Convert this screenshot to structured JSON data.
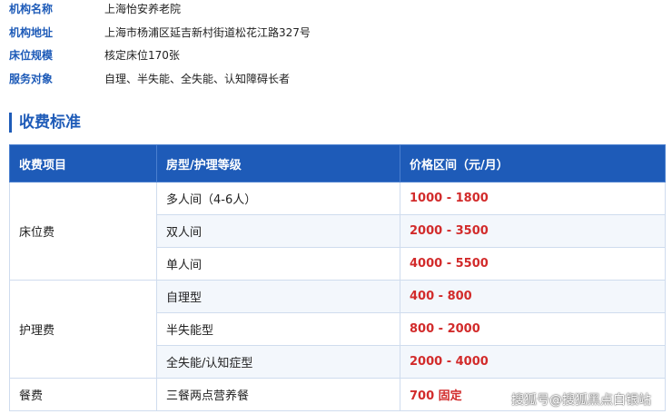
{
  "info": [
    {
      "label": "机构名称",
      "value": "上海怡安养老院"
    },
    {
      "label": "机构地址",
      "value": "上海市杨浦区延吉新村街道松花江路327号"
    },
    {
      "label": "床位规模",
      "value": "核定床位170张"
    },
    {
      "label": "服务对象",
      "value": "自理、半失能、全失能、认知障碍长者"
    }
  ],
  "section_title": "收费标准",
  "table": {
    "headers": [
      "收费项目",
      "房型/护理等级",
      "价格区间（元/月）"
    ],
    "groups": [
      {
        "category": "床位费",
        "rows": [
          {
            "sub": "多人间（4-6人）",
            "price": "1000 - 1800"
          },
          {
            "sub": "双人间",
            "price": "2000 - 3500"
          },
          {
            "sub": "单人间",
            "price": "4000 - 5500"
          }
        ]
      },
      {
        "category": "护理费",
        "rows": [
          {
            "sub": "自理型",
            "price": "400 - 800"
          },
          {
            "sub": "半失能型",
            "price": "800 - 2000"
          },
          {
            "sub": "全失能/认知症型",
            "price": "2000 - 4000"
          }
        ]
      },
      {
        "category": "餐费",
        "rows": [
          {
            "sub": "三餐两点营养餐",
            "price": "700 固定"
          }
        ]
      }
    ]
  },
  "watermark": "搜狐号@搜狐黑点白银站",
  "colors": {
    "accent": "#1e5bb8",
    "price": "#d22b2b",
    "stripe": "#f3f7fc"
  }
}
